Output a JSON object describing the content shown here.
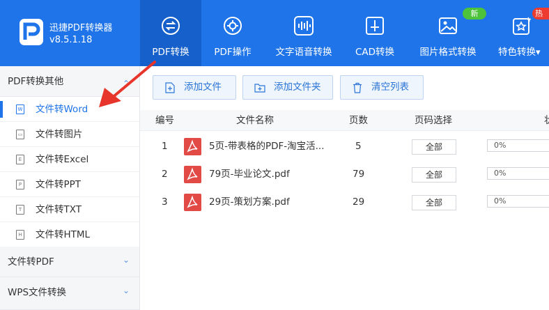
{
  "app": {
    "name": "迅捷PDF转换器",
    "version": "v8.5.1.18"
  },
  "nav": [
    {
      "label": "PDF转换",
      "icon": "convert-icon",
      "active": true
    },
    {
      "label": "PDF操作",
      "icon": "gear-icon",
      "active": false
    },
    {
      "label": "文字语音转换",
      "icon": "audio-wave-icon",
      "active": false
    },
    {
      "label": "CAD转换",
      "icon": "cad-icon",
      "active": false,
      "badge": "新"
    },
    {
      "label": "图片格式转换",
      "icon": "image-icon",
      "active": false
    },
    {
      "label": "特色转换",
      "icon": "star-icon",
      "active": false,
      "badge": "热",
      "dropdown": "▾"
    }
  ],
  "sidebar": {
    "groups": [
      {
        "label": "PDF转换其他",
        "chevron": "⌃"
      },
      {
        "label": "文件转PDF",
        "chevron": "⌄"
      },
      {
        "label": "WPS文件转换",
        "chevron": "⌄"
      }
    ],
    "items": [
      {
        "label": "文件转Word",
        "icon_glyph": "W",
        "active": true
      },
      {
        "label": "文件转图片",
        "icon_glyph": "▭",
        "active": false
      },
      {
        "label": "文件转Excel",
        "icon_glyph": "E",
        "active": false
      },
      {
        "label": "文件转PPT",
        "icon_glyph": "P",
        "active": false
      },
      {
        "label": "文件转TXT",
        "icon_glyph": "T",
        "active": false
      },
      {
        "label": "文件转HTML",
        "icon_glyph": "H",
        "active": false
      }
    ]
  },
  "toolbar": {
    "add_file": "添加文件",
    "add_folder": "添加文件夹",
    "clear_list": "清空列表"
  },
  "table": {
    "headers": [
      "编号",
      "文件名称",
      "页数",
      "页码选择",
      "状"
    ],
    "rows": [
      {
        "index": "1",
        "name": "5页-带表格的PDF-淘宝活...",
        "pages": "5",
        "page_select": "全部",
        "progress": "0%",
        "progress_value": 0
      },
      {
        "index": "2",
        "name": "79页-毕业论文.pdf",
        "pages": "79",
        "page_select": "全部",
        "progress": "0%",
        "progress_value": 0
      },
      {
        "index": "3",
        "name": "29页-策划方案.pdf",
        "pages": "29",
        "page_select": "全部",
        "progress": "0%",
        "progress_value": 0
      }
    ]
  },
  "colors": {
    "brand": "#1e74e8",
    "active_nav": "#1660cb",
    "annotation_arrow": "#e8352b",
    "pdf_icon": "#e14a45"
  }
}
